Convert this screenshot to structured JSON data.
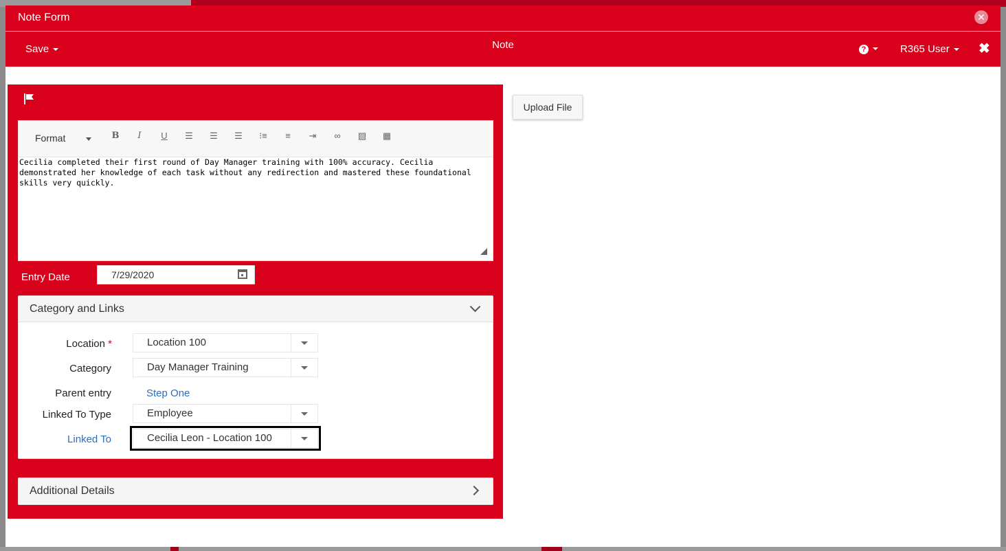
{
  "window": {
    "title": "Note Form",
    "close_icon": "close-circle-icon"
  },
  "toolbar": {
    "save_label": "Save",
    "center_title": "Note",
    "help_icon": "question-circle-icon",
    "user_label": "R365 User",
    "close_label": "✖"
  },
  "editor": {
    "format_label": "Format",
    "tools": [
      "bold",
      "italic",
      "underline",
      "align-left",
      "align-center",
      "align-right",
      "bulleted-list",
      "numbered-list",
      "indent",
      "link",
      "image",
      "table"
    ],
    "content": "Cecilia completed their first round of Day Manager training with 100% accuracy. Cecilia demonstrated her knowledge of each task without any redirection and mastered these foundational skills very quickly."
  },
  "entry_date": {
    "label": "Entry Date",
    "value": "7/29/2020"
  },
  "category_links": {
    "title": "Category and Links",
    "location_label": "Location",
    "location_required": "*",
    "location_value": "Location 100",
    "category_label": "Category",
    "category_value": "Day Manager Training",
    "parent_label": "Parent entry",
    "parent_value": "Step One",
    "linked_type_label": "Linked To Type",
    "linked_type_value": "Employee",
    "linked_to_label": "Linked To",
    "linked_to_value": "Cecilia Leon - Location 100"
  },
  "additional_details": {
    "title": "Additional Details"
  },
  "upload": {
    "label": "Upload File"
  },
  "colors": {
    "brand": "#d9001b",
    "link": "#2a6ebb"
  }
}
